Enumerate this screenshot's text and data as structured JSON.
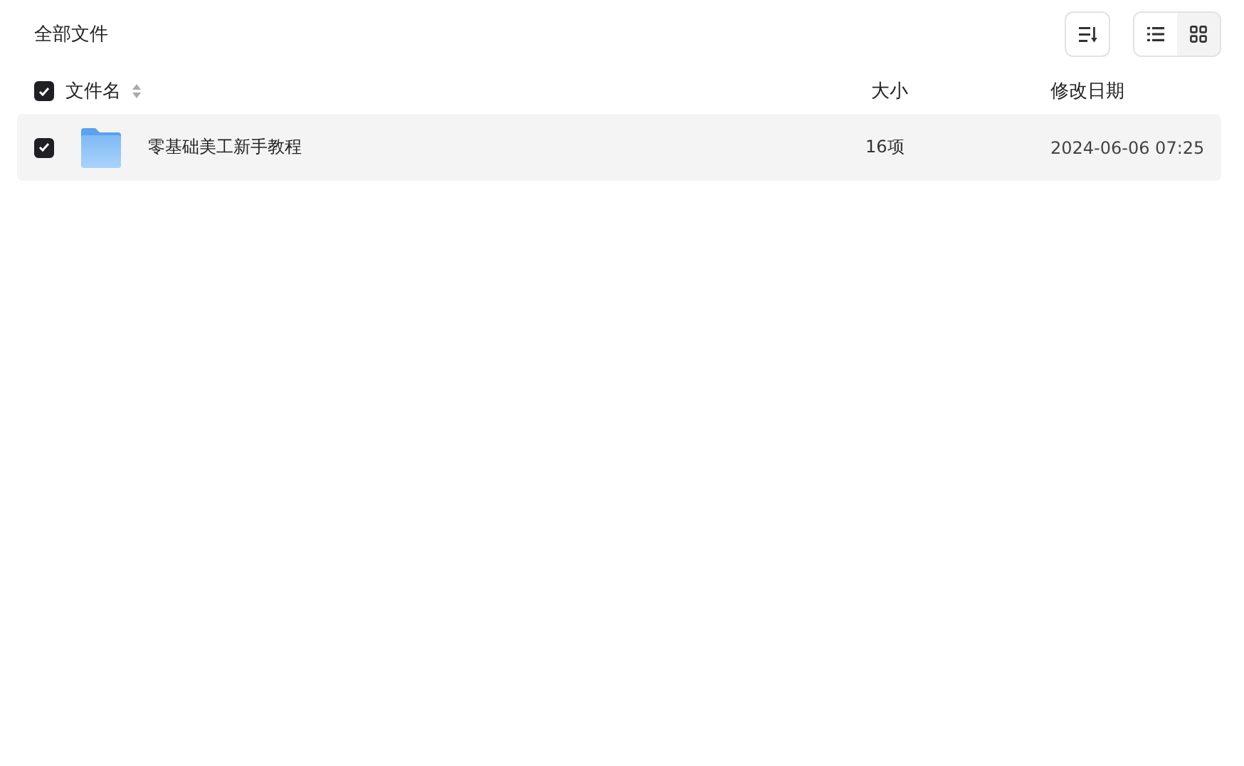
{
  "breadcrumb": "全部文件",
  "view_modes": [
    {
      "kind": "list",
      "selected": true
    },
    {
      "kind": "grid",
      "selected": false
    }
  ],
  "table": {
    "select_all": {
      "checked": true
    },
    "columns": [
      "文件名",
      "大小",
      "修改日期"
    ],
    "rows": [
      {
        "checked": true,
        "kind": "folder",
        "name": "零基础美工新手教程",
        "size": "16项",
        "modified": "2024-06-06 07:25"
      }
    ]
  }
}
